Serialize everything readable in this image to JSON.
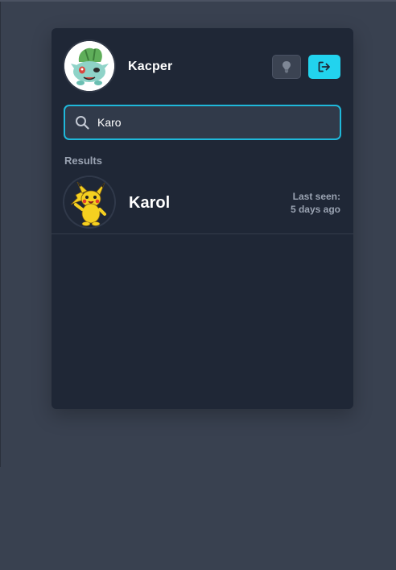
{
  "user": {
    "name": "Kacper",
    "avatar_icon": "bulbasaur-avatar"
  },
  "header_buttons": {
    "idea_icon": "lightbulb-icon",
    "logout_icon": "logout-icon"
  },
  "search": {
    "value": "Karo",
    "placeholder": ""
  },
  "results": {
    "label": "Results",
    "items": [
      {
        "name": "Karol",
        "avatar_icon": "pikachu-avatar",
        "last_seen_label": "Last seen:",
        "last_seen_value": "5 days ago"
      }
    ]
  },
  "colors": {
    "page_bg": "#394150",
    "panel_bg": "#1f2736",
    "accent": "#22d3ee",
    "search_border": "#1fb8da",
    "muted_text": "#9aa3b2"
  }
}
